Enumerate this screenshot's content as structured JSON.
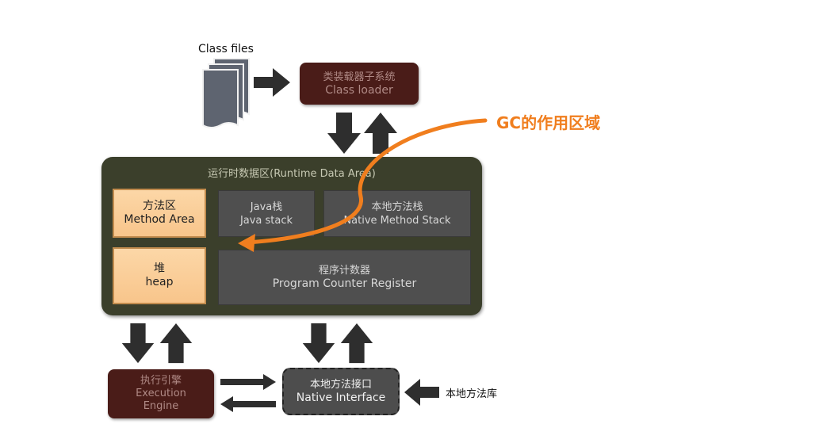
{
  "class_files": {
    "label": "Class files"
  },
  "class_loader": {
    "zh": "类装载器子系统",
    "en": "Class loader"
  },
  "runtime_area": {
    "title": "运行时数据区(Runtime Data Area)",
    "method_area": {
      "zh": "方法区",
      "en": "Method Area"
    },
    "java_stack": {
      "zh": "Java栈",
      "en": "Java stack"
    },
    "native_method_stack": {
      "zh": "本地方法栈",
      "en": "Native Method Stack"
    },
    "heap": {
      "zh": "堆",
      "en": "heap"
    },
    "program_counter": {
      "zh": "程序计数器",
      "en": "Program Counter Register"
    }
  },
  "execution_engine": {
    "zh": "执行引擎",
    "en1": "Execution",
    "en2": "Engine"
  },
  "native_interface": {
    "zh": "本地方法接口",
    "en": "Native Interface"
  },
  "native_library": {
    "label": "本地方法库"
  },
  "gc_annotation": {
    "label": "GC的作用区域",
    "color": "#f07e1e"
  },
  "colors": {
    "arrow": "#2e2e2e",
    "runtime_bg": "#3b3f2b",
    "highlight": "#f8c58b",
    "dark_red": "#4a1c18"
  }
}
